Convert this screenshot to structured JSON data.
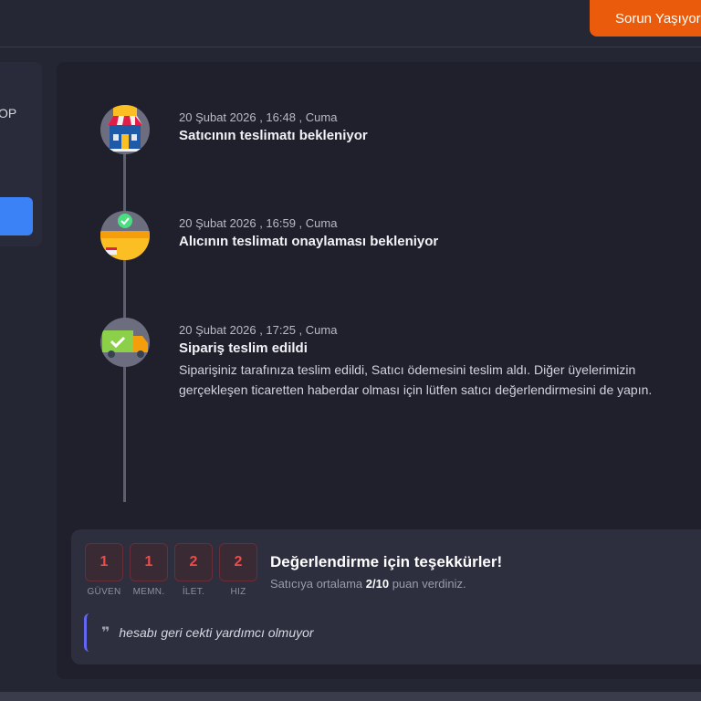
{
  "header": {
    "report_button": "Sorun Yaşıyorum",
    "report_icon": "warning-triangle-icon",
    "accent": "#ea5b0c"
  },
  "left_panel": {
    "text": "OP"
  },
  "timeline": [
    {
      "date": "20 Şubat 2026 , 16:48 , Cuma",
      "title": "Satıcının teslimatı bekleniyor",
      "icon": "store-icon"
    },
    {
      "date": "20 Şubat 2026 , 16:59 , Cuma",
      "title": "Alıcının teslimatı onaylaması bekleniyor",
      "icon": "box-check-icon"
    },
    {
      "date": "20 Şubat 2026 , 17:25 , Cuma",
      "title": "Sipariş teslim edildi",
      "icon": "delivery-truck-icon",
      "desc_line1": "Siparişiniz tarafınıza teslim edildi, Satıcı ödemesini teslim aldı. Diğer üyelerimizin",
      "desc_line2": "gerçekleşen ticaretten haberdar olması için lütfen satıcı değerlendirmesini de yapın."
    }
  ],
  "rating": {
    "scores": [
      {
        "value": "1",
        "label": "GÜVEN"
      },
      {
        "value": "1",
        "label": "MEMN."
      },
      {
        "value": "2",
        "label": "İLET."
      },
      {
        "value": "2",
        "label": "HIZ"
      }
    ],
    "title": "Değerlendirme için teşekkürler!",
    "sub_before": "Satıcıya ortalama ",
    "sub_value": "2/10",
    "sub_after": " puan verdiniz.",
    "quote_mark": "❞",
    "comment": "hesabı geri cekti yardımcı olmuyor"
  }
}
